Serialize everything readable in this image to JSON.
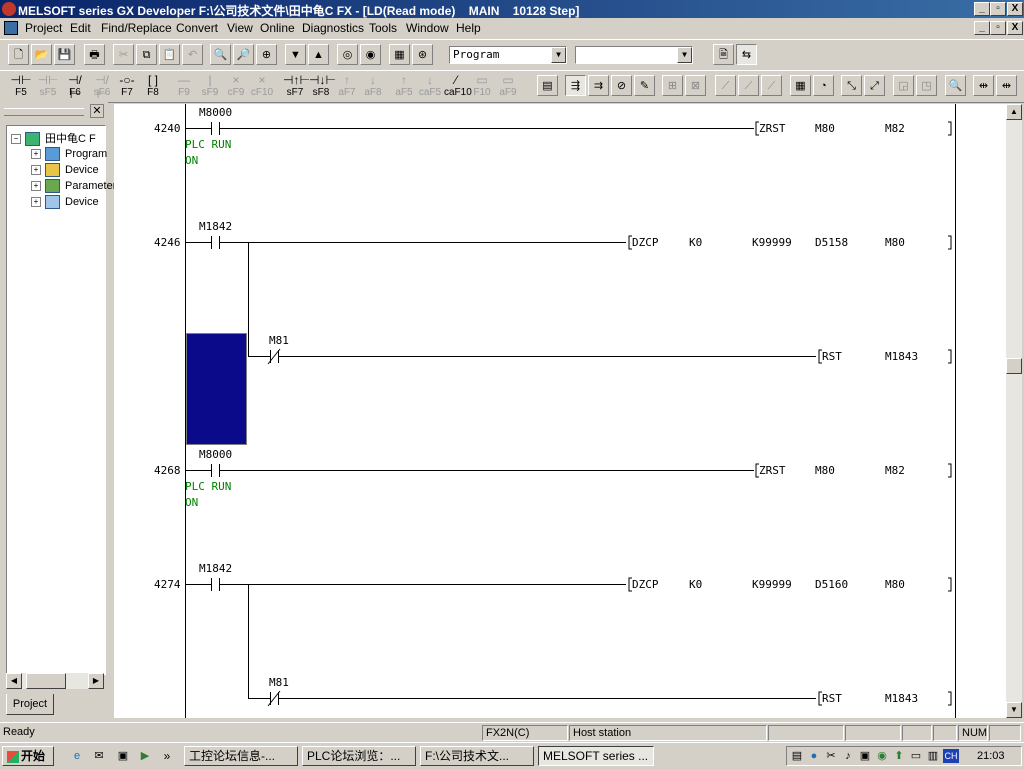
{
  "window": {
    "title": "MELSOFT series GX Developer F:\\公司技术文件\\田中龟C FX - [LD(Read mode)    MAIN    10128 Step]",
    "controls": [
      "_",
      "▫",
      "X"
    ]
  },
  "menu": [
    "Project",
    "Edit",
    "Find/Replace",
    "Convert",
    "View",
    "Online",
    "Diagnostics",
    "Tools",
    "Window",
    "Help"
  ],
  "toolbar": {
    "data_type_value": "Program",
    "second_combo_value": ""
  },
  "ladder_toolbar": {
    "keys": [
      "F5",
      "sF5",
      "F6",
      "sF6",
      "F7",
      "F8",
      "F9",
      "sF9",
      "cF9",
      "cF10",
      "sF7",
      "sF8",
      "aF7",
      "aF8",
      "aF5",
      "caF5",
      "caF10",
      "F10",
      "aF9"
    ]
  },
  "project_pane": {
    "tab": "Project",
    "root": "田中龟C F",
    "items": [
      "Program",
      "Device",
      "Parameter",
      "Device"
    ]
  },
  "ladder": {
    "rungs": [
      {
        "step": "4240",
        "contact": "M8000",
        "comment": [
          "PLC RUN",
          "ON"
        ],
        "instr": [
          "ZRST",
          "M80",
          "M82"
        ]
      },
      {
        "step": "4246",
        "contact": "M1842",
        "instr": [
          "DZCP",
          "K0",
          "K99999",
          "D5158",
          "M80"
        ],
        "branch_contact": "M81",
        "branch_instr": [
          "RST",
          "M1843"
        ]
      },
      {
        "step": "4268",
        "contact": "M8000",
        "comment": [
          "PLC RUN",
          "ON"
        ],
        "instr": [
          "ZRST",
          "M80",
          "M82"
        ]
      },
      {
        "step": "4274",
        "contact": "M1842",
        "instr": [
          "DZCP",
          "K0",
          "K99999",
          "D5160",
          "M80"
        ],
        "branch_contact": "M81",
        "branch_instr": [
          "RST",
          "M1843"
        ]
      }
    ]
  },
  "status_bar": {
    "state": "Ready",
    "plc": "FX2N(C)",
    "station": "Host station",
    "num": "NUM"
  },
  "taskbar": {
    "start": "开始",
    "tasks": [
      "工控论坛信息-...",
      "PLC论坛浏览：...",
      "F:\\公司技术文...",
      "MELSOFT series ..."
    ],
    "clock": "21:03",
    "ime": "CH"
  }
}
